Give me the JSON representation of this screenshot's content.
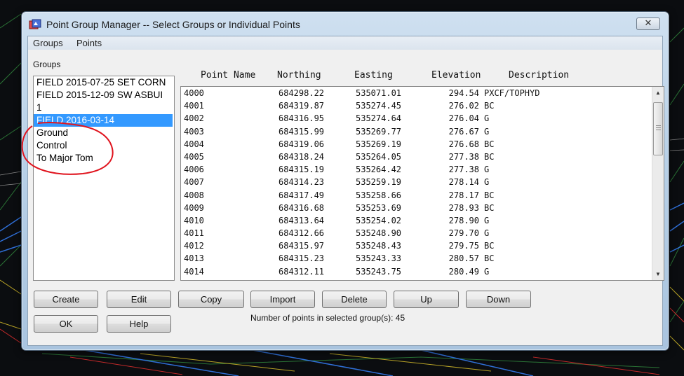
{
  "window": {
    "title": "Point Group Manager -- Select Groups or Individual Points",
    "close_label": "✕"
  },
  "menu": [
    "Groups",
    "Points"
  ],
  "groups": {
    "label": "Groups",
    "items": [
      {
        "label": "FIELD 2015-07-25 SET CORN"
      },
      {
        "label": "FIELD 2015-12-09 SW ASBUI"
      },
      {
        "label": "1"
      },
      {
        "label": "FIELD 2016-03-14",
        "selected": true
      },
      {
        "label": "Ground"
      },
      {
        "label": "Control"
      },
      {
        "label": "To Major Tom"
      }
    ]
  },
  "points": {
    "columns": [
      "Point Name",
      "Northing",
      "Easting",
      "Elevation",
      "Description"
    ],
    "rows": [
      [
        "4000",
        "684298.22",
        "535071.01",
        "294.54",
        "PXCF/TOPHYD"
      ],
      [
        "4001",
        "684319.87",
        "535274.45",
        "276.02",
        "BC"
      ],
      [
        "4002",
        "684316.95",
        "535274.64",
        "276.04",
        "G"
      ],
      [
        "4003",
        "684315.99",
        "535269.77",
        "276.67",
        "G"
      ],
      [
        "4004",
        "684319.06",
        "535269.19",
        "276.68",
        "BC"
      ],
      [
        "4005",
        "684318.24",
        "535264.05",
        "277.38",
        "BC"
      ],
      [
        "4006",
        "684315.19",
        "535264.42",
        "277.38",
        "G"
      ],
      [
        "4007",
        "684314.23",
        "535259.19",
        "278.14",
        "G"
      ],
      [
        "4008",
        "684317.49",
        "535258.66",
        "278.17",
        "BC"
      ],
      [
        "4009",
        "684316.68",
        "535253.69",
        "278.93",
        "BC"
      ],
      [
        "4010",
        "684313.64",
        "535254.02",
        "278.90",
        "G"
      ],
      [
        "4011",
        "684312.66",
        "535248.90",
        "279.70",
        "G"
      ],
      [
        "4012",
        "684315.97",
        "535248.43",
        "279.75",
        "BC"
      ],
      [
        "4013",
        "684315.23",
        "535243.33",
        "280.57",
        "BC"
      ],
      [
        "4014",
        "684312.11",
        "535243.75",
        "280.49",
        "G"
      ]
    ]
  },
  "buttons": {
    "create": "Create",
    "edit": "Edit",
    "copy": "Copy",
    "import": "Import",
    "delete": "Delete",
    "up": "Up",
    "down": "Down",
    "ok": "OK",
    "help": "Help"
  },
  "status": {
    "count_text": "Number of points in selected group(s):  45"
  },
  "colors": {
    "selection": "#3399ff",
    "annotation": "#e0141e",
    "cad_background": "#0b0d10"
  }
}
